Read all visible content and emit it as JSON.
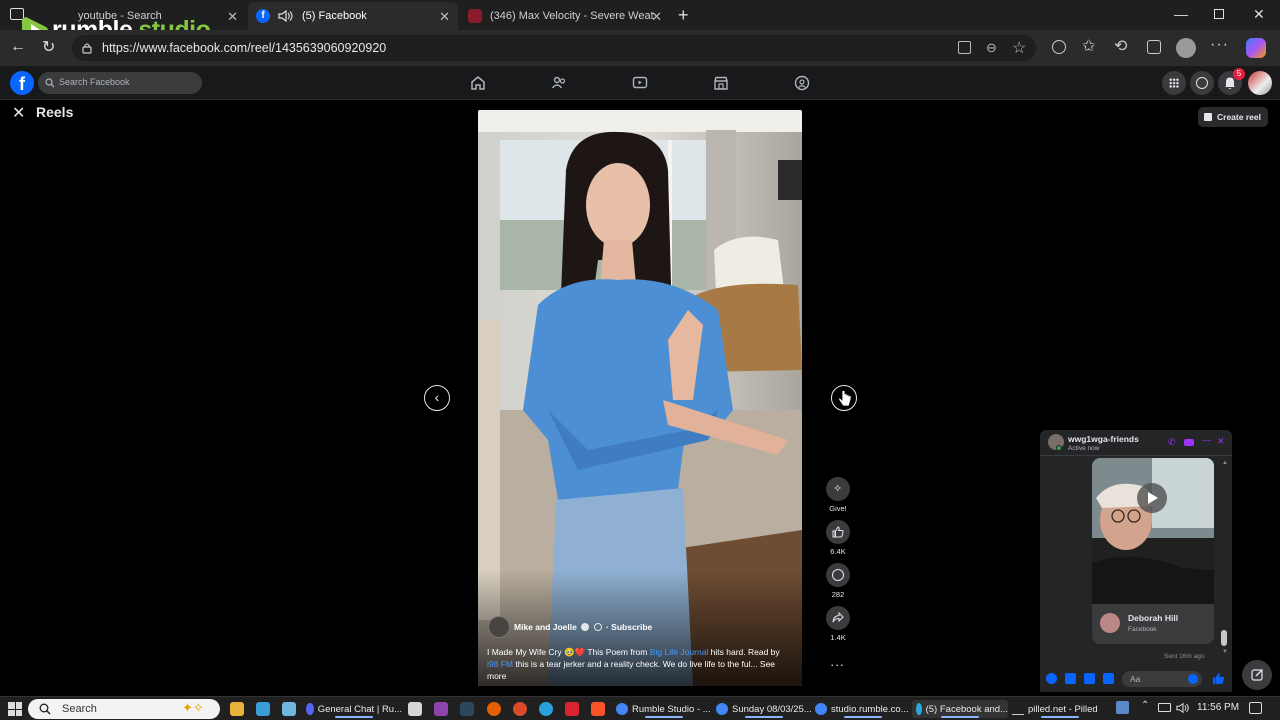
{
  "browser": {
    "tabs": [
      {
        "title": "youtube - Search",
        "active": false
      },
      {
        "title": "(5) Facebook",
        "active": true
      },
      {
        "title": "(346) Max Velocity - Severe Weat",
        "active": false
      }
    ],
    "url": "https://www.facebook.com/reel/1435639060920920"
  },
  "overlay_logo": {
    "text1": "rumble",
    "text2": "studio"
  },
  "facebook": {
    "search_placeholder": "Search Facebook",
    "notification_count": "5",
    "page_title": "Reels",
    "create_reel_label": "Create reel"
  },
  "reel": {
    "author": "Mike and Joelle",
    "subscribe_label": "· Subscribe",
    "caption_start": "I Made My Wife Cry 🥹❤️ This Poem from ",
    "caption_link1": "Big Life Journal",
    "caption_mid": " hits hard. Read by ",
    "caption_link2": "i98 FM",
    "caption_end": " this is a tear jerker and a reality check. We do live life to the ful... See more",
    "actions": {
      "give_label": "Give!",
      "like_count": "6.4K",
      "comment_count": "282",
      "share_count": "1.4K"
    }
  },
  "chat": {
    "name": "wwg1wga-friends",
    "status": "Active now",
    "shared_name": "Deborah Hill",
    "shared_source": "Facebook",
    "sent_label": "Sent 16m ago",
    "input_placeholder": "Aa"
  },
  "taskbar": {
    "search_label": "Search",
    "items": [
      "General Chat | Ru...",
      "Rumble Studio - ...",
      "Sunday 08/03/25...",
      "studio.rumble.co...",
      "(5) Facebook and...",
      "pilled.net - Pilled"
    ],
    "time": "11:56 PM"
  },
  "colors": {
    "fb_blue": "#0866ff",
    "link_blue": "#4599ff",
    "rumble_green": "#85c742",
    "chat_purple": "#a033ff"
  }
}
